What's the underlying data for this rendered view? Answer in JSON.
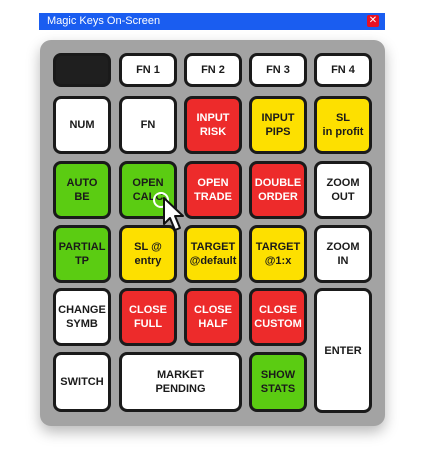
{
  "window": {
    "title": "Magic Keys On-Screen",
    "close_icon": "close-icon"
  },
  "colors": {
    "titlebar": "#1a5df0",
    "red": "#ed2b2b",
    "yellow": "#fde000",
    "green": "#5bcc12",
    "white": "#ffffff",
    "panel": "#a3a3a3"
  },
  "keys": {
    "blank": "",
    "fn1": "FN 1",
    "fn2": "FN 2",
    "fn3": "FN 3",
    "fn4": "FN 4",
    "num": "NUM",
    "fn": "FN",
    "input_risk": "INPUT\nRISK",
    "input_pips": "INPUT\nPIPS",
    "sl_in_profit": "SL\nin profit",
    "auto_be": "AUTO\nBE",
    "open_calc": "OPEN\nCALC",
    "open_trade": "OPEN\nTRADE",
    "double_order": "DOUBLE\nORDER",
    "zoom_out": "ZOOM\nOUT",
    "partial_tp": "PARTIAL\nTP",
    "sl_at_entry": "SL @\nentry",
    "target_default": "TARGET\n@default",
    "target_1x": "TARGET\n@1:x",
    "zoom_in": "ZOOM\nIN",
    "change_symb": "CHANGE\nSYMB",
    "close_full": "CLOSE\nFULL",
    "close_half": "CLOSE\nHALF",
    "close_custom": "CLOSE\nCUSTOM",
    "enter": "ENTER",
    "switch": "SWITCH",
    "market_pending": "MARKET\nPENDING",
    "show_stats": "SHOW\nSTATS"
  },
  "cursor": {
    "icon": "mouse-pointer-icon"
  }
}
